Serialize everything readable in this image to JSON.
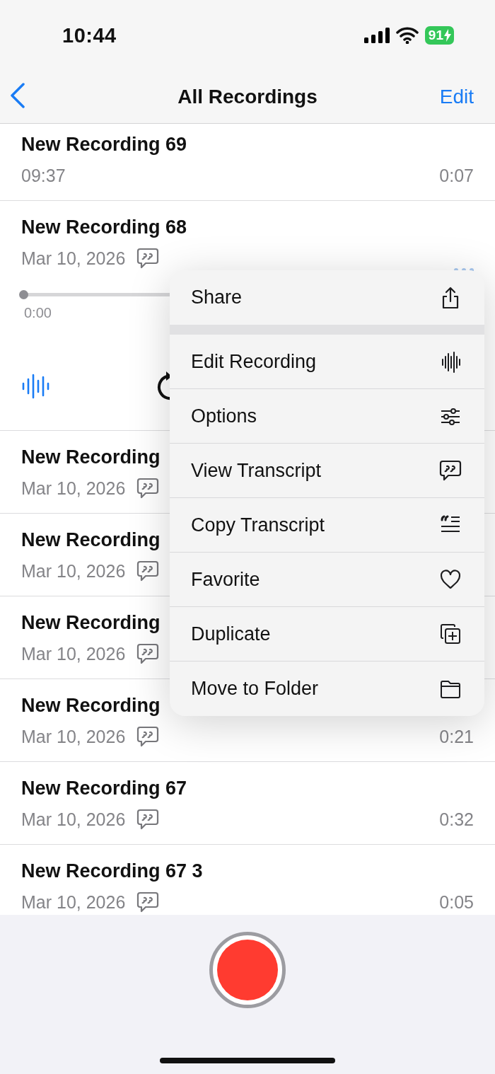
{
  "status_bar": {
    "time": "10:44",
    "battery": "91"
  },
  "nav": {
    "title": "All Recordings",
    "edit": "Edit"
  },
  "recordings": [
    {
      "title": "New Recording 69",
      "date": "09:37",
      "duration": "0:07",
      "transcript": false,
      "expanded": false
    },
    {
      "title": "New Recording 68",
      "date": "Mar 10, 2026",
      "transcript": true,
      "expanded": true,
      "player": {
        "level": 0,
        "elapsed": "0:00"
      }
    },
    {
      "title": "New Recording",
      "date": "Mar 10, 2026",
      "transcript": true,
      "expanded": false
    },
    {
      "title": "New Recording",
      "date": "Mar 10, 2026",
      "transcript": true,
      "expanded": false
    },
    {
      "title": "New Recording",
      "date": "Mar 10, 2026",
      "transcript": true,
      "expanded": false
    },
    {
      "title": "New Recording",
      "date": "Mar 10, 2026",
      "duration": "0:21",
      "transcript": true,
      "expanded": false
    },
    {
      "title": "New Recording 67",
      "date": "Mar 10, 2026",
      "duration": "0:32",
      "transcript": true,
      "expanded": false
    },
    {
      "title": "New Recording 67 3",
      "date": "Mar 10, 2026",
      "duration": "0:05",
      "transcript": true,
      "expanded": false
    }
  ],
  "context_menu": {
    "sections": [
      [
        {
          "label": "Share"
        }
      ],
      [
        {
          "label": "Edit Recording"
        },
        {
          "label": "Options"
        },
        {
          "label": "View Transcript"
        },
        {
          "label": "Copy Transcript"
        },
        {
          "label": "Favorite"
        },
        {
          "label": "Duplicate"
        },
        {
          "label": "Move to Folder"
        }
      ]
    ]
  }
}
